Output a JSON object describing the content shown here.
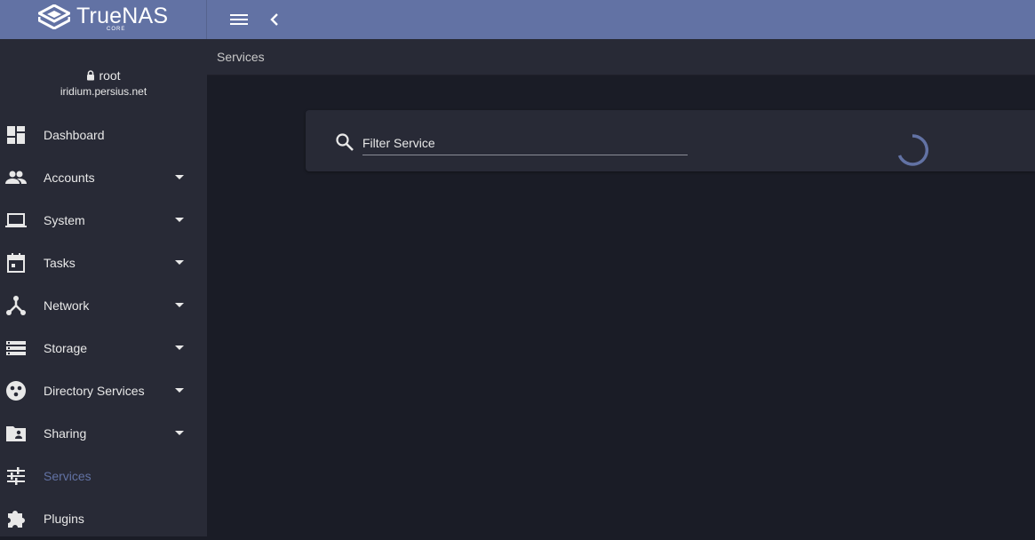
{
  "brand": {
    "name": "TrueNAS",
    "edition": "CORE"
  },
  "user": {
    "name": "root",
    "host": "iridium.persius.net"
  },
  "breadcrumb": "Services",
  "search": {
    "placeholder": "Filter Service",
    "value": ""
  },
  "colors": {
    "accent": "#6272a4",
    "sidebar": "#282a36",
    "background": "#1a1c26"
  },
  "sidebar": {
    "items": [
      {
        "label": "Dashboard",
        "icon": "dashboard-icon",
        "expandable": false,
        "active": false
      },
      {
        "label": "Accounts",
        "icon": "people-icon",
        "expandable": true,
        "active": false
      },
      {
        "label": "System",
        "icon": "laptop-icon",
        "expandable": true,
        "active": false
      },
      {
        "label": "Tasks",
        "icon": "calendar-icon",
        "expandable": true,
        "active": false
      },
      {
        "label": "Network",
        "icon": "network-icon",
        "expandable": true,
        "active": false
      },
      {
        "label": "Storage",
        "icon": "storage-icon",
        "expandable": true,
        "active": false
      },
      {
        "label": "Directory Services",
        "icon": "directory-icon",
        "expandable": true,
        "active": false
      },
      {
        "label": "Sharing",
        "icon": "shared-folder-icon",
        "expandable": true,
        "active": false
      },
      {
        "label": "Services",
        "icon": "tune-icon",
        "expandable": false,
        "active": true
      },
      {
        "label": "Plugins",
        "icon": "puzzle-icon",
        "expandable": false,
        "active": false
      }
    ]
  }
}
